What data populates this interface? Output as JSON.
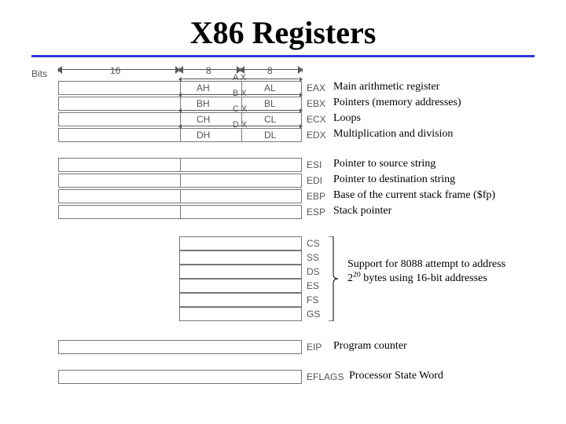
{
  "title": "X86 Registers",
  "header": {
    "bits_label": "Bits",
    "seg16": "16",
    "seg8a": "8",
    "seg8b": "8"
  },
  "group1": {
    "rows": [
      {
        "xlabel": "A X",
        "hi": "AH",
        "lo": "AL",
        "name": "EAX",
        "desc": "Main arithmetic register"
      },
      {
        "xlabel": "B X",
        "hi": "BH",
        "lo": "BL",
        "name": "EBX",
        "desc": "Pointers (memory addresses)"
      },
      {
        "xlabel": "C X",
        "hi": "CH",
        "lo": "CL",
        "name": "ECX",
        "desc": "Loops"
      },
      {
        "xlabel": "D X",
        "hi": "DH",
        "lo": "DL",
        "name": "EDX",
        "desc": "Multiplication and division"
      }
    ]
  },
  "group2": {
    "rows": [
      {
        "name": "ESI",
        "desc": "Pointer to source string"
      },
      {
        "name": "EDI",
        "desc": "Pointer to destination string"
      },
      {
        "name": "EBP",
        "desc": "Base of the current stack frame ($fp)"
      },
      {
        "name": "ESP",
        "desc": "Stack pointer"
      }
    ]
  },
  "group3": {
    "rows": [
      {
        "name": "CS"
      },
      {
        "name": "SS"
      },
      {
        "name": "DS"
      },
      {
        "name": "ES"
      },
      {
        "name": "FS"
      },
      {
        "name": "GS"
      }
    ],
    "note_pre": "Support for 8088 attempt to address 2",
    "note_sup": "20",
    "note_post": " bytes using 16-bit addresses"
  },
  "group4": {
    "rows": [
      {
        "name": "EIP",
        "desc": "Program counter"
      }
    ]
  },
  "group5": {
    "rows": [
      {
        "name": "EFLAGS",
        "desc": "Processor State Word"
      }
    ]
  },
  "chart_data": {
    "type": "table",
    "title": "X86 Registers",
    "bit_segments": [
      16,
      8,
      8
    ],
    "registers": [
      {
        "name": "EAX",
        "width_bits": 32,
        "sub16": "AX",
        "hi8": "AH",
        "lo8": "AL",
        "description": "Main arithmetic register"
      },
      {
        "name": "EBX",
        "width_bits": 32,
        "sub16": "BX",
        "hi8": "BH",
        "lo8": "BL",
        "description": "Pointers (memory addresses)"
      },
      {
        "name": "ECX",
        "width_bits": 32,
        "sub16": "CX",
        "hi8": "CH",
        "lo8": "CL",
        "description": "Loops"
      },
      {
        "name": "EDX",
        "width_bits": 32,
        "sub16": "DX",
        "hi8": "DH",
        "lo8": "DL",
        "description": "Multiplication and division"
      },
      {
        "name": "ESI",
        "width_bits": 32,
        "description": "Pointer to source string"
      },
      {
        "name": "EDI",
        "width_bits": 32,
        "description": "Pointer to destination string"
      },
      {
        "name": "EBP",
        "width_bits": 32,
        "description": "Base of the current stack frame ($fp)"
      },
      {
        "name": "ESP",
        "width_bits": 32,
        "description": "Stack pointer"
      },
      {
        "name": "CS",
        "width_bits": 16,
        "group": "segment",
        "note": "Support for 8088 attempt to address 2^20 bytes using 16-bit addresses"
      },
      {
        "name": "SS",
        "width_bits": 16,
        "group": "segment"
      },
      {
        "name": "DS",
        "width_bits": 16,
        "group": "segment"
      },
      {
        "name": "ES",
        "width_bits": 16,
        "group": "segment"
      },
      {
        "name": "FS",
        "width_bits": 16,
        "group": "segment"
      },
      {
        "name": "GS",
        "width_bits": 16,
        "group": "segment"
      },
      {
        "name": "EIP",
        "width_bits": 32,
        "description": "Program counter"
      },
      {
        "name": "EFLAGS",
        "width_bits": 32,
        "description": "Processor State Word"
      }
    ]
  }
}
